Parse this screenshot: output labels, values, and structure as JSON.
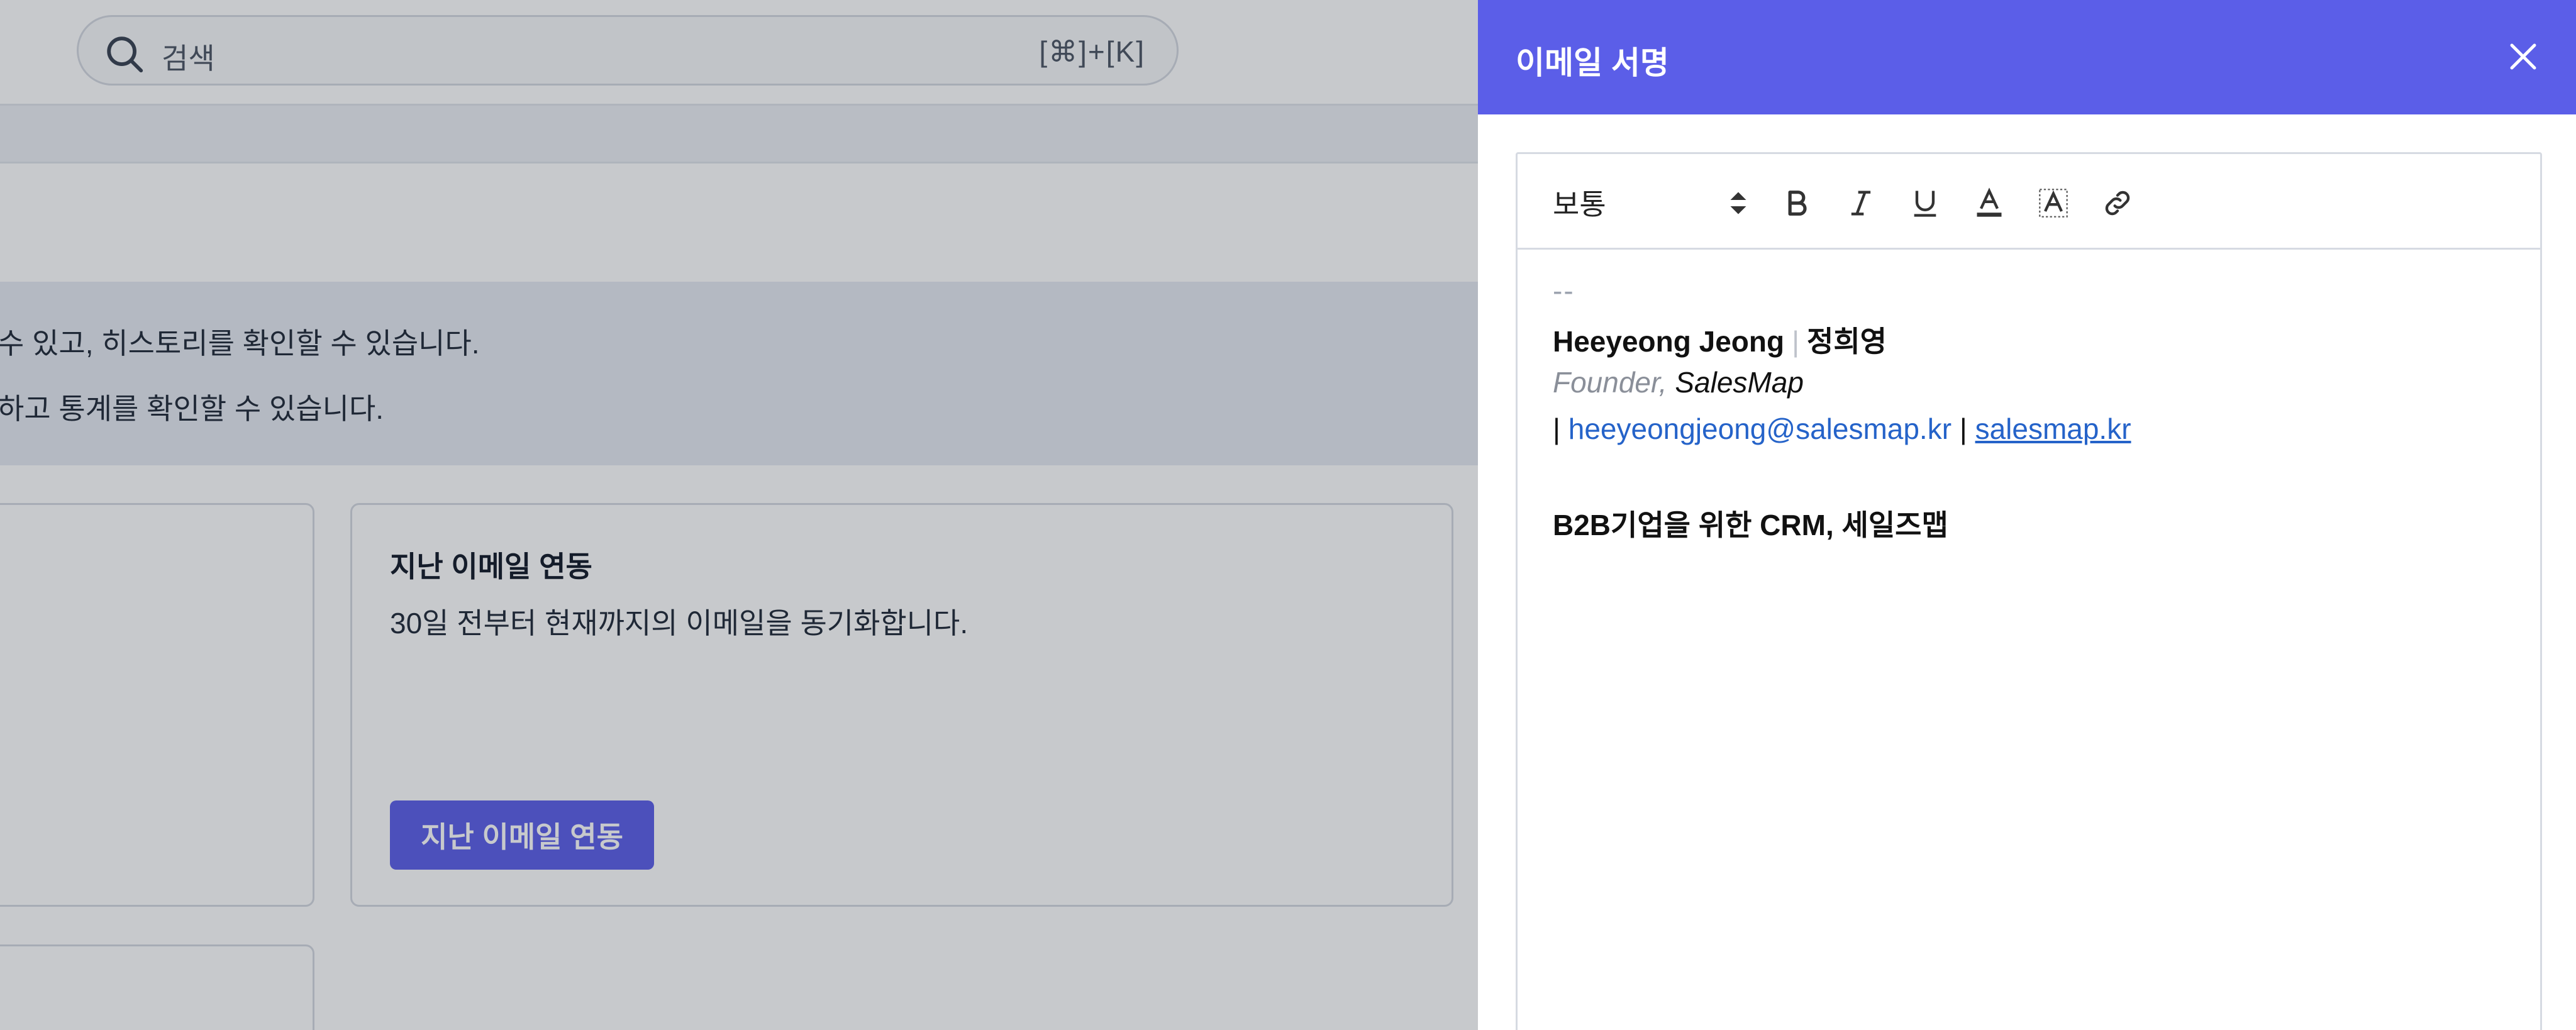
{
  "background": {
    "search": {
      "placeholder": "검색",
      "shortcut": "[⌘]+[K]"
    },
    "info_lines": [
      "수 있고, 히스토리를 확인할 수 있습니다.",
      "하고 통계를 확인할 수 있습니다."
    ],
    "card_past_sync": {
      "title": "지난 이메일 연동",
      "description": "30일 전부터 현재까지의 이메일을 동기화합니다.",
      "button_label": "지난 이메일 연동"
    }
  },
  "drawer": {
    "title": "이메일 서명",
    "toolbar": {
      "format_select_value": "보통",
      "buttons": [
        "bold-icon",
        "italic-icon",
        "underline-icon",
        "text-color-icon",
        "highlight-icon",
        "link-icon"
      ]
    },
    "signature": {
      "dash": "--",
      "name_en": "Heeyeong Jeong",
      "separator": "|",
      "name_ko": "정희영",
      "role": "Founder,",
      "company": "SalesMap",
      "contact_prefix": "|",
      "email": "heeyeongjeong@salesmap.kr",
      "contact_separator": "|",
      "website": "salesmap.kr",
      "tagline": "B2B기업을 위한 CRM, 세일즈맵"
    }
  },
  "colors": {
    "accent": "#5b5ee8",
    "link": "#2563c9"
  }
}
